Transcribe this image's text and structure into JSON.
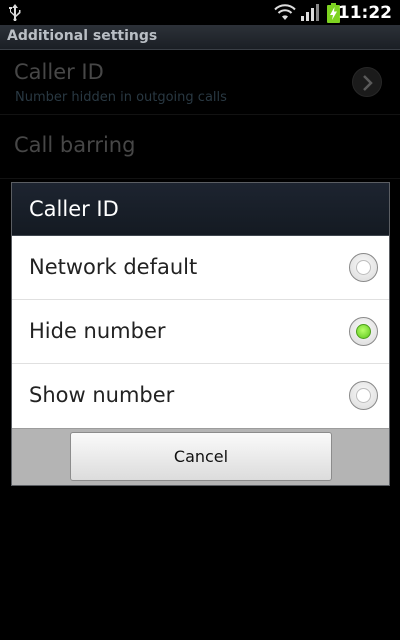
{
  "status_bar": {
    "time": "11:22",
    "icons": [
      "usb-icon",
      "wifi-icon",
      "signal-icon",
      "battery-charging-icon"
    ]
  },
  "title_bar": {
    "title": "Additional settings"
  },
  "background_list": {
    "items": [
      {
        "title": "Caller ID",
        "summary": "Number hidden in outgoing calls"
      },
      {
        "title": "Call barring"
      }
    ]
  },
  "dialog": {
    "title": "Caller ID",
    "options": [
      {
        "label": "Network default",
        "checked": false
      },
      {
        "label": "Hide number",
        "checked": true
      },
      {
        "label": "Show number",
        "checked": false
      }
    ],
    "cancel_label": "Cancel"
  },
  "colors": {
    "radio_checked": "#5ac619",
    "dialog_title_bg": "#1d2430"
  }
}
